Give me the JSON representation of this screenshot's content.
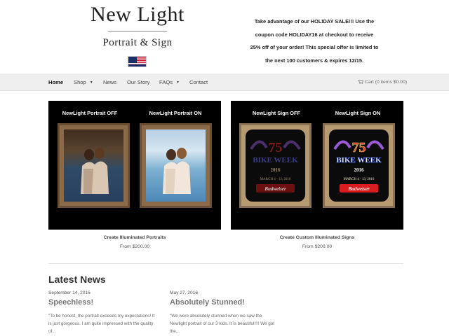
{
  "header": {
    "logo_name": "New Light",
    "logo_sub": "Portrait & Sign",
    "flag_icon": "us-flag-icon",
    "promo_lines": [
      "Take advantage of our HOLIDAY SALE!!! Use the",
      "coupon code HOLIDAY16 at checkout to receive",
      "25% off of your order! This special offer is limited to",
      "the next 100 customers & expires 12/15."
    ]
  },
  "nav": {
    "items": [
      {
        "label": "Home",
        "active": true
      },
      {
        "label": "Shop",
        "dropdown": true
      },
      {
        "label": "News"
      },
      {
        "label": "Our Story"
      },
      {
        "label": "FAQs",
        "dropdown": true
      },
      {
        "label": "Contact"
      }
    ],
    "cart_label": "Cart (0 items $0.00)",
    "cart_icon": "cart-icon"
  },
  "products": [
    {
      "name": "Create Illuminated Portraits",
      "price": "From $200.00",
      "label_off": "NewLight Portrait OFF",
      "label_on": "NewLight Portrait ON"
    },
    {
      "name": "Create Custom Illuminated Signs",
      "price": "From $200.00",
      "label_off": "NewLight Sign OFF",
      "label_on": "NewLight Sign ON",
      "sign_text": {
        "number": "75",
        "title": "BIKE WEEK",
        "year": "2016",
        "dates": "MARCH 4 - 13, 2016",
        "brand": "Budweiser"
      }
    }
  ],
  "news": {
    "heading": "Latest News",
    "posts": [
      {
        "date": "September 14, 2016",
        "title": "Speechless!",
        "excerpt_lines": [
          "\"To be honest, the portrait exceeds my expectations! It",
          "is just gorgeous. I am quite impressed with the quality",
          "of..."
        ]
      },
      {
        "date": "May 27, 2016",
        "title": "Absolutely Stunned!",
        "excerpt_lines": [
          "\"We were absolutely stunned when we saw the",
          "Newlight portrait of our 3 kids. It is beautiful!!!! We got",
          "the..."
        ]
      }
    ]
  },
  "colors": {
    "nav_bg": "#efefef",
    "panel_bg": "#000000",
    "sign_red": "#c8102e",
    "sign_gold": "#e0b23a",
    "sign_purple": "#6a3d9a"
  }
}
